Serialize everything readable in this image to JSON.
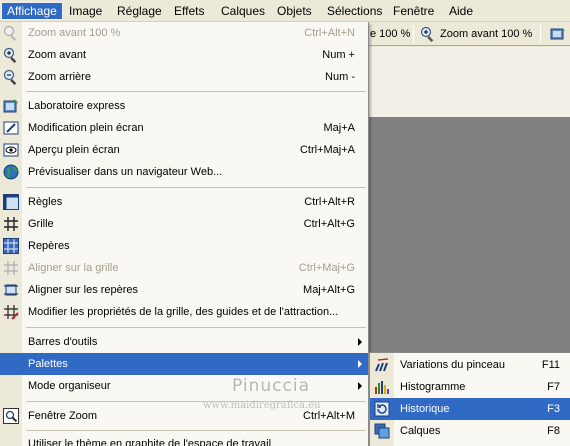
{
  "menubar": {
    "items": [
      "Affichage",
      "Image",
      "Réglage",
      "Effets",
      "Calques",
      "Objets",
      "Sélections",
      "Fenêtre",
      "Aide"
    ]
  },
  "toolbar": {
    "zoom_label_1": "e 100 %",
    "zoom_label_2": "Zoom avant 100 %"
  },
  "menu": {
    "items": [
      {
        "label": "Zoom avant 100 %",
        "shortcut": "Ctrl+Alt+N",
        "icon": "zoom-100-icon",
        "enabled": false
      },
      {
        "label": "Zoom avant",
        "shortcut": "Num +",
        "icon": "zoom-in-icon",
        "enabled": true
      },
      {
        "label": "Zoom arrière",
        "shortcut": "Num -",
        "icon": "zoom-out-icon",
        "enabled": true
      },
      {
        "label": "Laboratoire express",
        "shortcut": "",
        "icon": "express-lab-icon",
        "enabled": true
      },
      {
        "label": "Modification plein écran",
        "shortcut": "Maj+A",
        "icon": "fullscreen-edit-icon",
        "enabled": true
      },
      {
        "label": "Aperçu plein écran",
        "shortcut": "Ctrl+Maj+A",
        "icon": "fullscreen-preview-icon",
        "enabled": true
      },
      {
        "label": "Prévisualiser dans un navigateur Web...",
        "shortcut": "",
        "icon": "web-preview-icon",
        "enabled": true
      },
      {
        "label": "Règles",
        "shortcut": "Ctrl+Alt+R",
        "icon": "rulers-icon",
        "enabled": true
      },
      {
        "label": "Grille",
        "shortcut": "Ctrl+Alt+G",
        "icon": "grid-icon",
        "enabled": true
      },
      {
        "label": "Repères",
        "shortcut": "",
        "icon": "guides-icon",
        "enabled": true
      },
      {
        "label": "Aligner sur la grille",
        "shortcut": "Ctrl+Maj+G",
        "icon": "snap-grid-icon",
        "enabled": false
      },
      {
        "label": "Aligner sur les repères",
        "shortcut": "Maj+Alt+G",
        "icon": "snap-guides-icon",
        "enabled": true
      },
      {
        "label": "Modifier les propriétés de la grille, des guides et de l'attraction...",
        "shortcut": "",
        "icon": "grid-properties-icon",
        "enabled": true
      },
      {
        "label": "Barres d'outils",
        "shortcut": "",
        "icon": "",
        "enabled": true
      },
      {
        "label": "Palettes",
        "shortcut": "",
        "icon": "",
        "enabled": true
      },
      {
        "label": "Mode organiseur",
        "shortcut": "",
        "icon": "",
        "enabled": true
      },
      {
        "label": "Fenêtre Zoom",
        "shortcut": "Ctrl+Alt+M",
        "icon": "zoom-window-icon",
        "enabled": true
      },
      {
        "label": "Utiliser le thème en graphite de l'espace de travail",
        "shortcut": "",
        "icon": "",
        "enabled": true
      }
    ]
  },
  "submenu": {
    "items": [
      {
        "label": "Variations du pinceau",
        "shortcut": "F11",
        "icon": "brush-variations-icon"
      },
      {
        "label": "Histogramme",
        "shortcut": "F7",
        "icon": "histogram-icon"
      },
      {
        "label": "Historique",
        "shortcut": "F3",
        "icon": "history-icon"
      },
      {
        "label": "Calques",
        "shortcut": "F8",
        "icon": "layers-icon"
      }
    ]
  },
  "watermark": {
    "name": "Pinuccia",
    "site": "www.maidiregrafica.eu"
  },
  "colors": {
    "highlight": "#316ac5",
    "menu_bg": "#f9f8f3",
    "chrome": "#ece9d8",
    "disabled_text": "#a39e8f"
  }
}
